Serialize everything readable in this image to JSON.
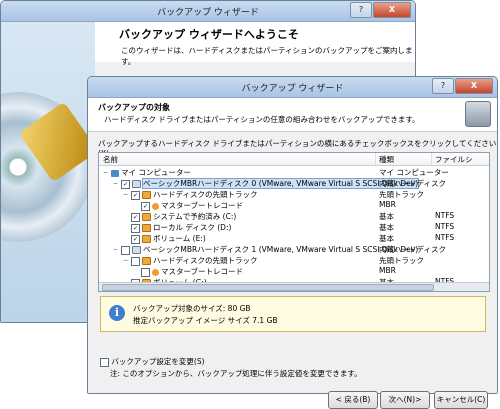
{
  "back_window": {
    "title": "バックアップ ウィザード",
    "heading": "バックアップ ウィザードへようこそ",
    "description": "このウィザードは、ハードディスクまたはパーティションのバックアップをご案内します。",
    "controls": {
      "help": "?",
      "close": "X"
    }
  },
  "front_window": {
    "title": "バックアップ ウィザード",
    "controls": {
      "help": "?",
      "close": "X"
    },
    "header_title": "バックアップの対象",
    "header_subtitle": "ハードディスク ドライブまたはパーティションの任意の組み合わせをバックアップできます。",
    "instruction": "バックアップするハードディスク ドライブまたはパーティションの横にあるチェックボックスをクリックしてください(X)",
    "columns": {
      "name": "名前",
      "type": "種類",
      "fs": "ファイルシ"
    },
    "tree": [
      {
        "name": "マイ コンピューター",
        "type": "マイ コンピューター",
        "fs": "",
        "level": 0,
        "check": "",
        "expander": "−",
        "icon": "pc"
      },
      {
        "name": "ベーシックMBRハードディスク 0 (VMware, VMware Virtual S SCSI Disk Dev)",
        "type": "内蔵ハードディスク",
        "fs": "",
        "level": 1,
        "check": "✓",
        "expander": "−",
        "icon": "disk",
        "selected": true
      },
      {
        "name": "ハードディスクの先頭トラック",
        "type": "先頭トラック",
        "fs": "",
        "level": 2,
        "check": "✓",
        "expander": "−",
        "icon": "part"
      },
      {
        "name": "マスターブートレコード",
        "type": "MBR",
        "fs": "",
        "level": 3,
        "check": "✓",
        "expander": "",
        "icon": "mbr"
      },
      {
        "name": "システムで予約済み (C:)",
        "type": "基本",
        "fs": "NTFS",
        "level": 2,
        "check": "✓",
        "expander": "",
        "icon": "part"
      },
      {
        "name": "ローカル ディスク (D:)",
        "type": "基本",
        "fs": "NTFS",
        "level": 2,
        "check": "✓",
        "expander": "",
        "icon": "part"
      },
      {
        "name": "ボリューム (E:)",
        "type": "基本",
        "fs": "NTFS",
        "level": 2,
        "check": "✓",
        "expander": "",
        "icon": "part"
      },
      {
        "name": "ベーシックMBRハードディスク 1 (VMware, VMware Virtual S SCSI Disk Dev)",
        "type": "内蔵ハードディスク",
        "fs": "",
        "level": 1,
        "check": "",
        "expander": "−",
        "icon": "disk"
      },
      {
        "name": "ハードディスクの先頭トラック",
        "type": "先頭トラック",
        "fs": "",
        "level": 2,
        "check": "",
        "expander": "−",
        "icon": "part"
      },
      {
        "name": "マスターブートレコード",
        "type": "MBR",
        "fs": "",
        "level": 3,
        "check": "",
        "expander": "",
        "icon": "mbr"
      },
      {
        "name": "ボリューム (G:)",
        "type": "基本",
        "fs": "NTFS",
        "level": 2,
        "check": "",
        "expander": "",
        "icon": "part"
      }
    ],
    "info": {
      "line1": "バックアップ対象のサイズ:  80 GB",
      "line2": "推定バックアップ イメージ サイズ  7.1 GB"
    },
    "change_settings_label": "バックアップ設定を変更(S)",
    "note": "注: このオプションから、バックアップ処理に伴う設定値を変更できます。",
    "buttons": {
      "back": "< 戻る(B)",
      "next": "次へ(N)>",
      "cancel": "キャンセル(C)"
    }
  }
}
